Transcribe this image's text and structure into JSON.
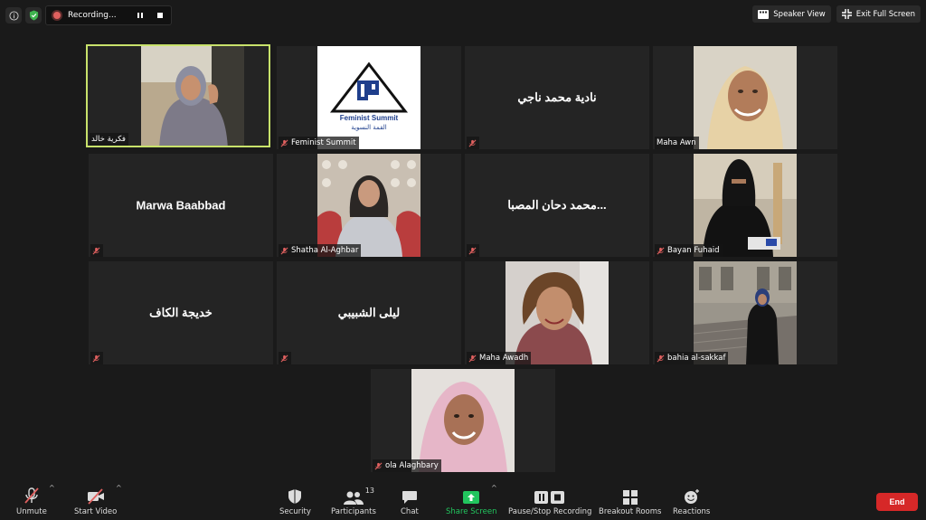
{
  "top_bar": {
    "recording_label": "Recording...",
    "speaker_view_label": "Speaker View",
    "exit_full_screen_label": "Exit Full Screen"
  },
  "participants": [
    {
      "name": "فكرية خالد",
      "has_video": true,
      "active_speaker": true
    },
    {
      "name": "Feminist Summit",
      "has_video": true,
      "logo": true
    },
    {
      "name": "نادية محمد ناجي",
      "has_video": false
    },
    {
      "name": "Maha Awn",
      "has_video": true
    },
    {
      "name": "Marwa Baabbad",
      "has_video": false
    },
    {
      "name": "Shatha Al-Aghbar",
      "has_video": true
    },
    {
      "name": "محمد دحان المصبا...",
      "has_video": false
    },
    {
      "name": "Bayan Fuhaid",
      "has_video": true
    },
    {
      "name": "خديجة الكاف",
      "has_video": false
    },
    {
      "name": "ليلى الشبيبي",
      "has_video": false
    },
    {
      "name": "Maha Awadh",
      "has_video": true
    },
    {
      "name": "bahia al-sakkaf",
      "has_video": true
    },
    {
      "name": "ola Alaghbary",
      "has_video": true
    }
  ],
  "logo": {
    "text": "Feminist Summit",
    "arabic_text": "القمة النسوية"
  },
  "toolbar": {
    "unmute_label": "Unmute",
    "start_video_label": "Start Video",
    "security_label": "Security",
    "participants_label": "Participants",
    "participants_count": "13",
    "chat_label": "Chat",
    "share_screen_label": "Share Screen",
    "pause_recording_label": "Pause/Stop Recording",
    "breakout_rooms_label": "Breakout Rooms",
    "reactions_label": "Reactions",
    "end_label": "End"
  },
  "colors": {
    "active_speaker_border": "#c8e26b",
    "share_screen": "#22c55e",
    "end_button": "#d62828",
    "mic_muted": "#e0605f"
  }
}
